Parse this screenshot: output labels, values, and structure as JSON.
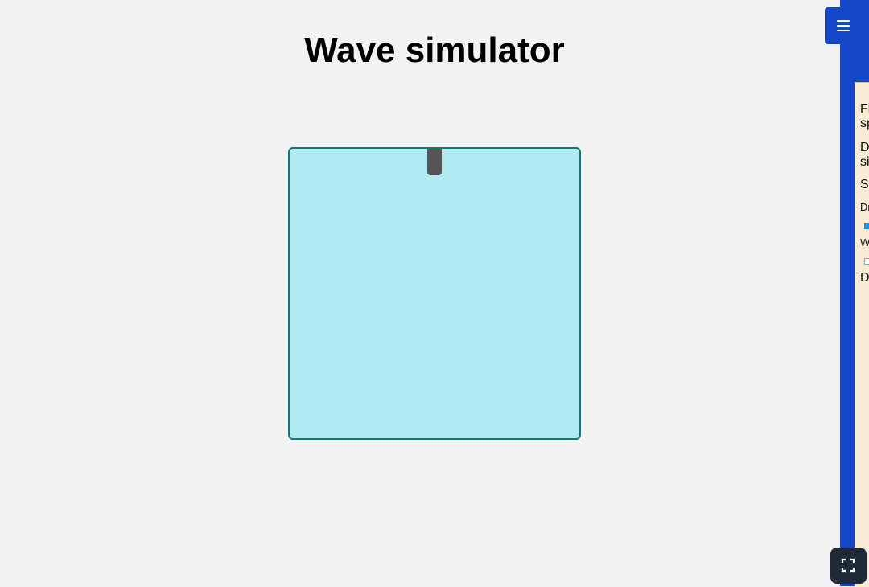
{
  "page": {
    "title": "Wave simulator"
  },
  "controls": {
    "menu_icon": "hamburger-menu-icon",
    "fullscreen_icon": "fullscreen-icon"
  },
  "panel": {
    "lines": [
      "Fl",
      "sp",
      "D",
      "si",
      "S",
      "Dr",
      "W",
      "D"
    ]
  },
  "colors": {
    "background": "#f2f2f2",
    "tank_fill": "#b3ebf4",
    "tank_border": "#0c7a74",
    "source": "#555555",
    "panel_bar": "#1447c8",
    "panel_body": "#f8ecd6",
    "fullscreen_button": "#1e2a38"
  }
}
